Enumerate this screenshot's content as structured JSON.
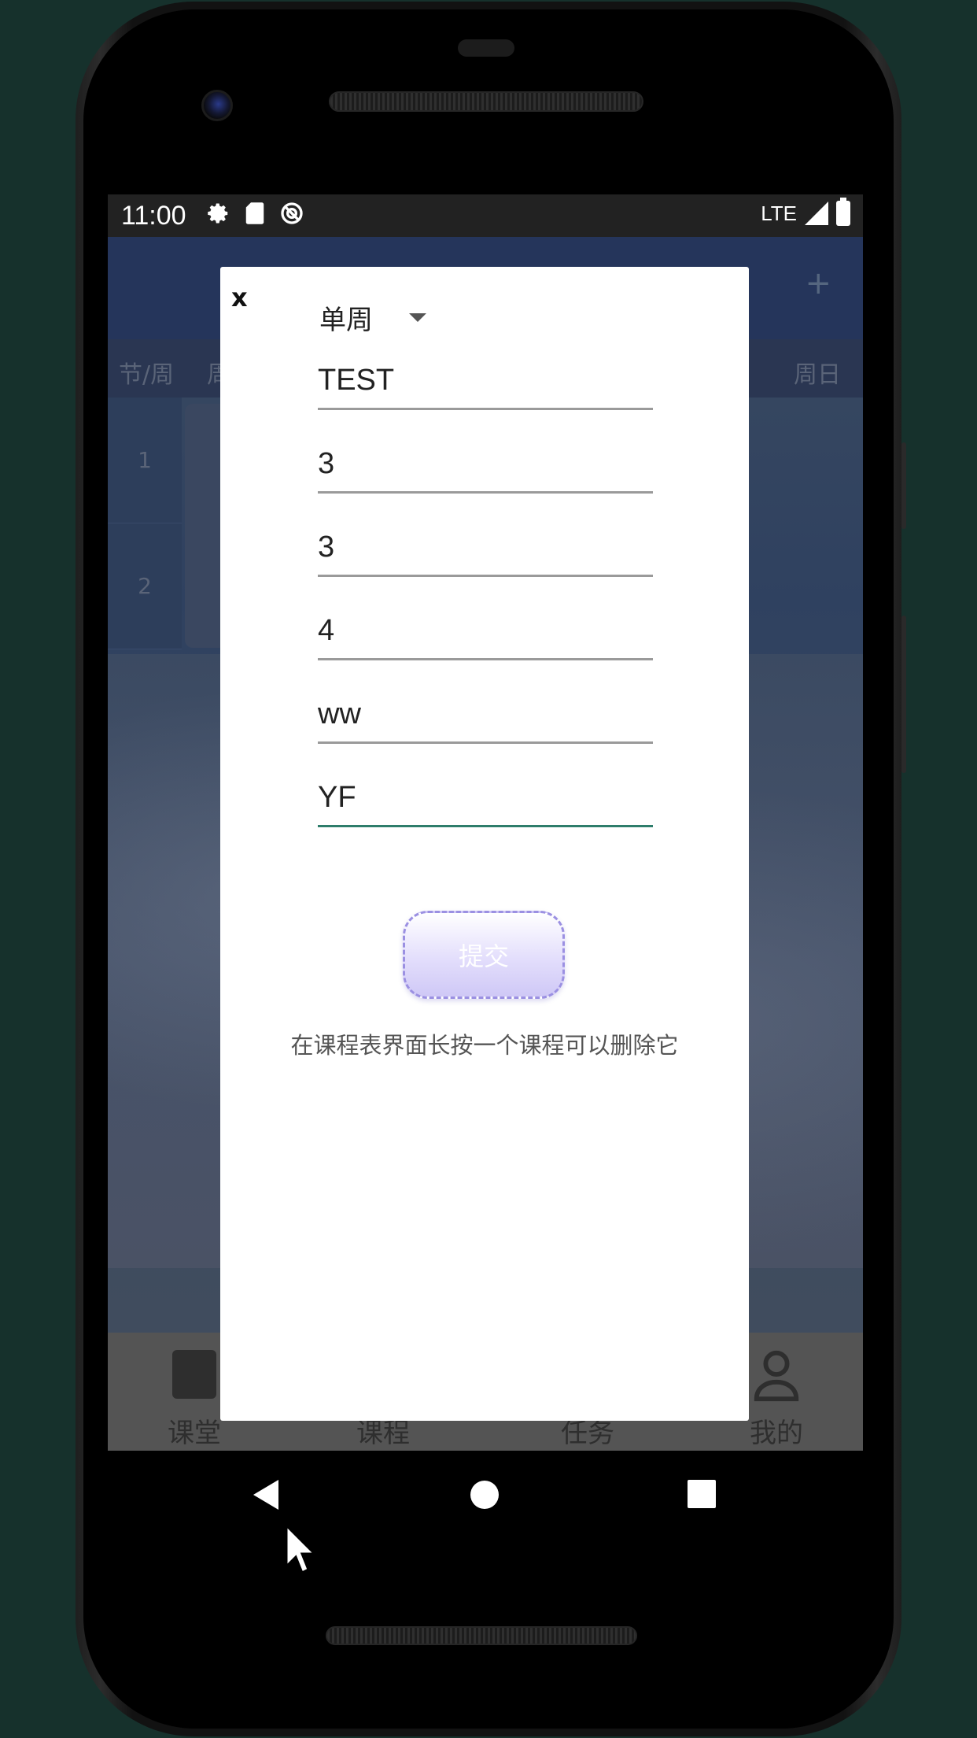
{
  "status_bar": {
    "time": "11:00",
    "network": "LTE",
    "icons": [
      "settings-icon",
      "sd-card-icon",
      "sync-icon",
      "signal-icon",
      "battery-icon"
    ]
  },
  "background_app": {
    "header_plus": "+",
    "week_header_left": "节/周",
    "week_header_left2": "周",
    "week_header_right": "周日",
    "periods": [
      "1",
      "2"
    ],
    "tabs": [
      {
        "label": "课堂",
        "icon": "clipboard-icon"
      },
      {
        "label": "课程",
        "icon": "book-icon"
      },
      {
        "label": "任务",
        "icon": "task-icon"
      },
      {
        "label": "我的",
        "icon": "person-icon"
      }
    ]
  },
  "dialog": {
    "close_label": "x",
    "week_type": "单周",
    "fields": {
      "course_name": "TEST",
      "weekday": "3",
      "start_period": "3",
      "end_period": "4",
      "teacher": "ww",
      "classroom": "YF"
    },
    "submit_label": "提交",
    "hint": "在课程表界面长按一个课程可以删除它"
  },
  "colors": {
    "accent_underline": "#2e7d6b",
    "submit_border": "#9b90e2",
    "header_bg": "#25355b"
  }
}
